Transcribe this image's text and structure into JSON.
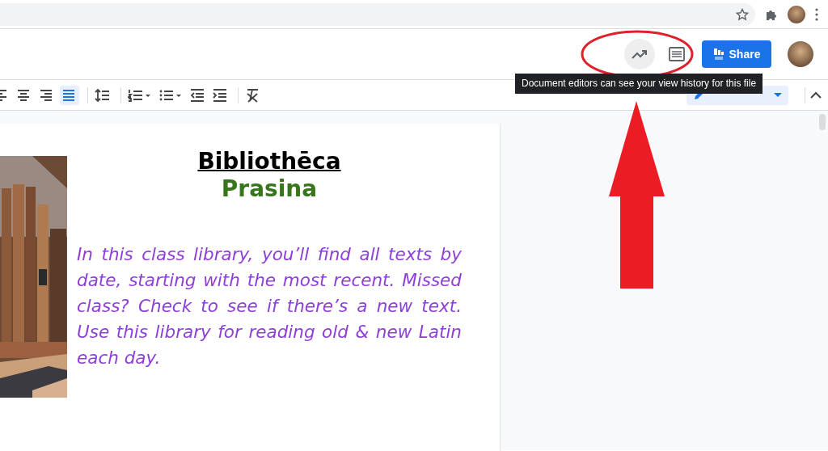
{
  "header": {
    "share_button": "Share",
    "tooltip": "Document editors can see your view history for this file"
  },
  "toolbar": {
    "items": [
      {
        "kind": "align-left",
        "selected": false
      },
      {
        "kind": "align-center",
        "selected": false
      },
      {
        "kind": "align-right",
        "selected": false
      },
      {
        "kind": "align-justify",
        "selected": true
      },
      {
        "kind": "line-spacing",
        "selected": false
      },
      {
        "kind": "numbered-list",
        "selected": false
      },
      {
        "kind": "bulleted-list",
        "selected": false
      },
      {
        "kind": "decrease-indent",
        "selected": false
      },
      {
        "kind": "increase-indent",
        "selected": false
      },
      {
        "kind": "clear-formatting",
        "selected": false
      }
    ]
  },
  "document": {
    "title": "Bibliothēca",
    "subtitle": "Prasina",
    "paragraph": "In this class library, you’ll find all texts by date, starting with the most recent. Missed class? Check to see if there’s a new text. Use this library for reading old & new Latin each day."
  }
}
